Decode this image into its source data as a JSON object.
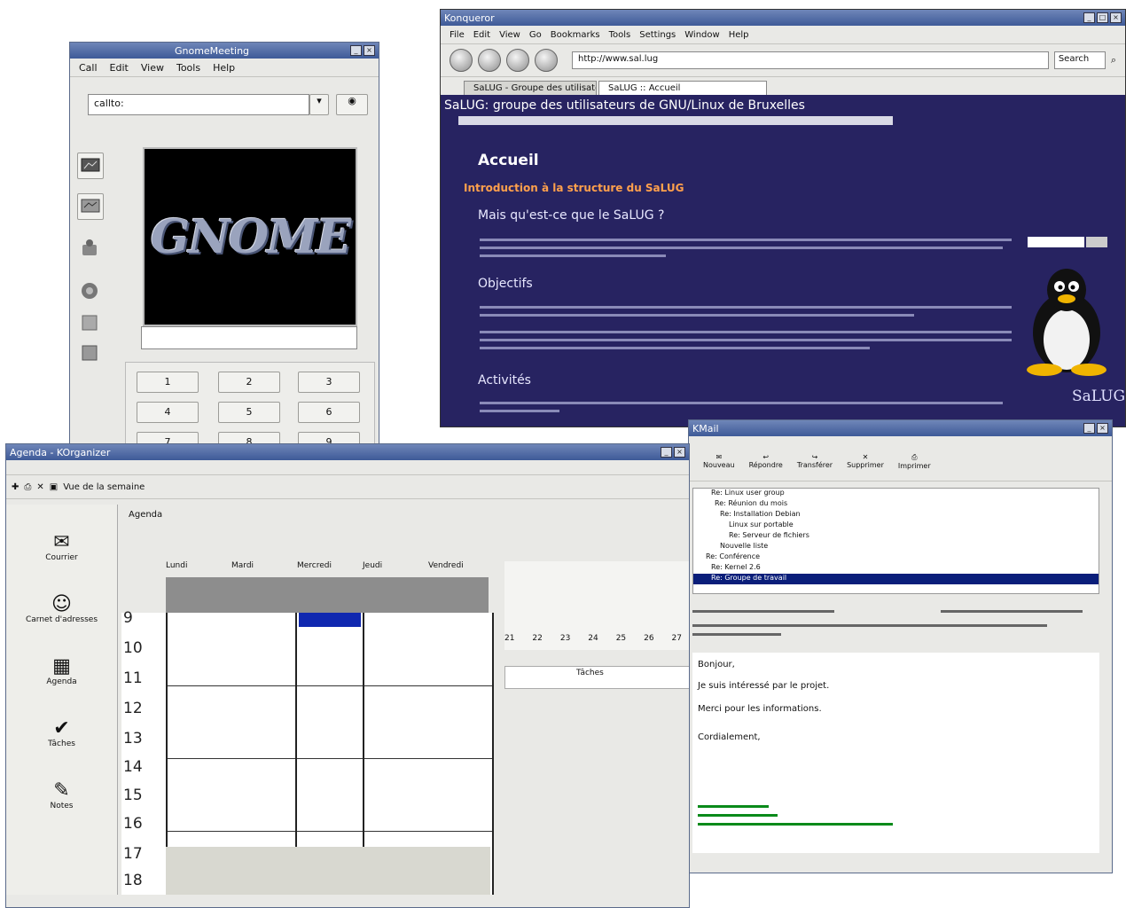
{
  "gnomemeeting": {
    "title": "GnomeMeeting",
    "menu": [
      "Call",
      "Edit",
      "View",
      "Tools",
      "Help"
    ],
    "address_value": "callto:",
    "logo_text": "GNOME",
    "keypad": [
      "1",
      "2",
      "3",
      "4",
      "5",
      "6",
      "7",
      "8",
      "9"
    ]
  },
  "browser": {
    "title": "Konqueror",
    "menu": [
      "File",
      "Edit",
      "View",
      "Go",
      "Bookmarks",
      "Tools",
      "Settings",
      "Window",
      "Help"
    ],
    "url": "http://www.sal.lug",
    "search_placeholder": "Search",
    "tabs": [
      "SaLUG - Groupe des utilisateurs",
      "SaLUG :: Accueil"
    ],
    "site_title": "SaLUG: groupe des utilisateurs de GNU/Linux de Bruxelles",
    "heading": "Accueil",
    "intro": "Introduction à la structure du SaLUG",
    "sections": [
      "Mais qu'est-ce que le SaLUG ?",
      "Objectifs",
      "Activités"
    ],
    "brand": "SaLUG"
  },
  "agenda": {
    "title": "Agenda - KOrganizer",
    "toolbar_label": "Vue de la semaine",
    "nav": [
      "Courrier",
      "Carnet d'adresses",
      "Agenda",
      "Tâches",
      "Notes"
    ],
    "header": "Agenda",
    "days": [
      "Lundi",
      "Mardi",
      "Mercredi",
      "Jeudi",
      "Vendredi"
    ],
    "hours": [
      "9",
      "10",
      "11",
      "12",
      "13",
      "14",
      "15",
      "16",
      "17",
      "18"
    ],
    "minical_row": [
      "21",
      "22",
      "23",
      "24",
      "25",
      "26",
      "27"
    ],
    "todo_header": "Tâches"
  },
  "mail": {
    "title": "KMail",
    "tools": [
      "Nouveau",
      "Répondre",
      "Transférer",
      "Supprimer",
      "Imprimer"
    ],
    "messages": [
      "Re: Linux user group",
      "Re: Réunion du mois",
      "Re: Installation Debian",
      "Linux sur portable",
      "Re: Serveur de fichiers",
      "Nouvelle liste",
      "Re: Conférence",
      "Re: Kernel 2.6",
      "Re: Groupe de travail"
    ],
    "body_lines": [
      "Bonjour,",
      "Je suis intéressé par le projet.",
      "Merci pour les informations.",
      "Cordialement,"
    ]
  }
}
